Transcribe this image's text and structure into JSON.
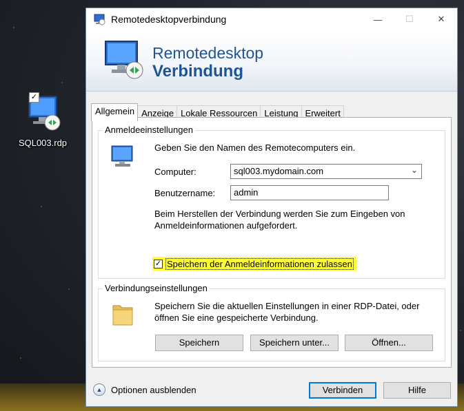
{
  "desktop": {
    "icon_label": "SQL003.rdp",
    "icon_checkmark": "✓"
  },
  "window": {
    "title": "Remotedesktopverbindung",
    "minimize_glyph": "—",
    "maximize_glyph": "☐",
    "close_glyph": "✕"
  },
  "banner": {
    "line1": "Remotedesktop",
    "line2": "Verbindung",
    "title_color": "#1f5494"
  },
  "tabs": [
    {
      "label": "Allgemein",
      "active": true
    },
    {
      "label": "Anzeige"
    },
    {
      "label": "Lokale Ressourcen"
    },
    {
      "label": "Leistung"
    },
    {
      "label": "Erweitert"
    }
  ],
  "logon": {
    "group_title": "Anmeldeeinstellungen",
    "intro": "Geben Sie den Namen des Remotecomputers ein.",
    "computer_label": "Computer:",
    "computer_value": "sql003.mydomain.com",
    "username_label": "Benutzername:",
    "username_value": "admin",
    "info": "Beim Herstellen der Verbindung werden Sie zum Eingeben von Anmeldeinformationen aufgefordert.",
    "save_credentials_label": "Speichern der Anmeldeinformationen zulassen",
    "save_credentials_checked": true,
    "highlight_color": "#ffff3a"
  },
  "connection": {
    "group_title": "Verbindungseinstellungen",
    "description": "Speichern Sie die aktuellen Einstellungen in einer RDP-Datei, oder öffnen Sie eine gespeicherte Verbindung.",
    "save_label": "Speichern",
    "save_as_label": "Speichern unter...",
    "open_label": "Öffnen..."
  },
  "footer": {
    "options_label": "Optionen ausblenden",
    "connect_label": "Verbinden",
    "help_label": "Hilfe"
  }
}
